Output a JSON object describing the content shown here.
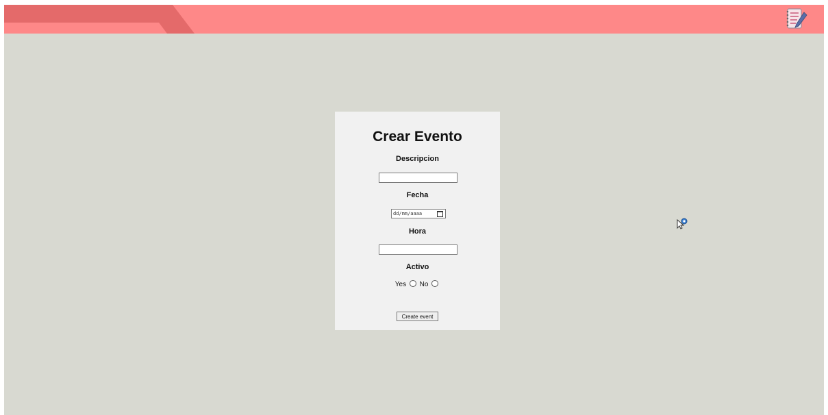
{
  "form": {
    "title": "Crear Evento",
    "descripcion_label": "Descripcion",
    "descripcion_value": "",
    "fecha_label": "Fecha",
    "fecha_placeholder": "dd/mm/aaaa",
    "hora_label": "Hora",
    "hora_value": "",
    "activo_label": "Activo",
    "radio_yes_label": "Yes",
    "radio_no_label": "No",
    "submit_label": "Create event"
  },
  "header": {
    "icon": "notebook-pen-icon"
  },
  "colors": {
    "header": "#fe8888",
    "header_tab": "#e46a6a",
    "background": "#d8d9d1",
    "card": "#f1f1f1"
  }
}
